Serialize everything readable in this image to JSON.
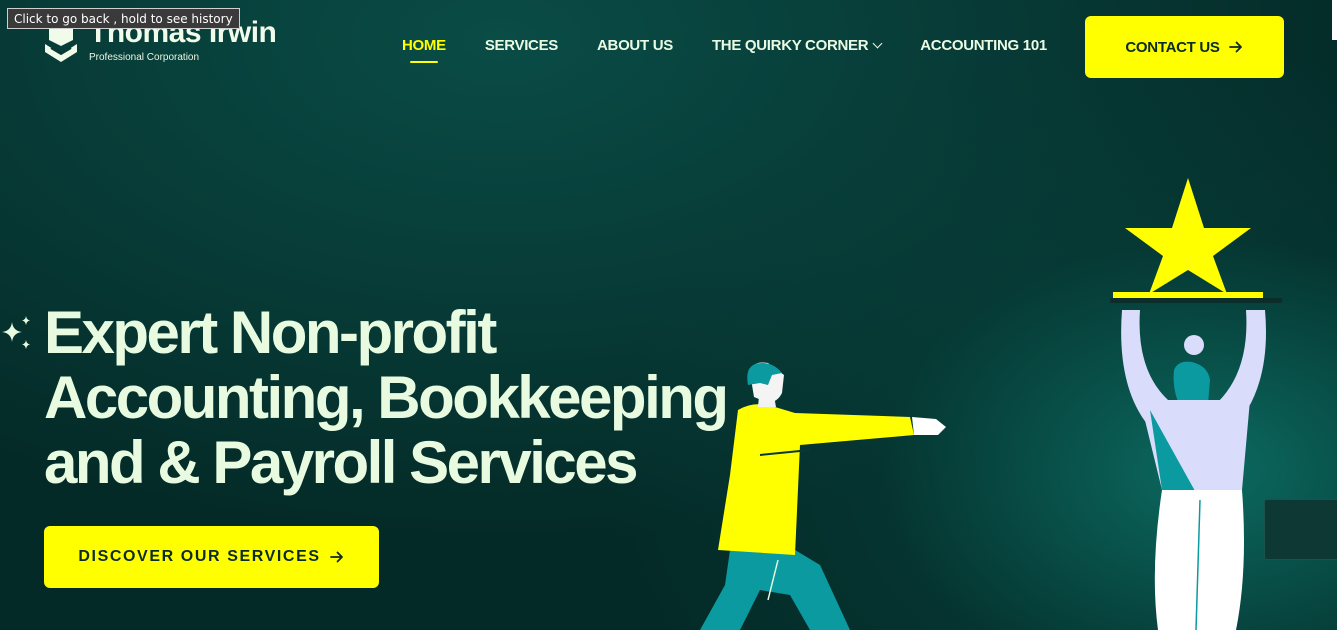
{
  "tooltip": {
    "text": "Click to go back , hold to see history"
  },
  "brand": {
    "name": "Thomas Irwin",
    "subtitle": "Professional Corporation"
  },
  "nav": {
    "items": [
      {
        "label": "HOME",
        "active": true
      },
      {
        "label": "SERVICES",
        "active": false
      },
      {
        "label": "ABOUT US",
        "active": false
      },
      {
        "label": "THE QUIRKY CORNER",
        "active": false,
        "has_dropdown": true
      },
      {
        "label": "ACCOUNTING 101",
        "active": false
      }
    ],
    "contact_label": "CONTACT US"
  },
  "hero": {
    "title": "Expert Non-profit Accounting, Bookkeeping and & Payroll Services",
    "cta_label": "DISCOVER OUR SERVICES"
  },
  "colors": {
    "accent": "#ffff00",
    "background": "#063b37",
    "text": "#e8fbe1",
    "illustration_teal": "#0a9aa0",
    "illustration_lavender": "#d9dcfb"
  },
  "icons": {
    "logo": "book-person-logo-icon",
    "sparkle": "sparkle-icon",
    "arrow": "arrow-right-icon",
    "chevron": "chevron-down-icon",
    "star": "star-icon"
  }
}
